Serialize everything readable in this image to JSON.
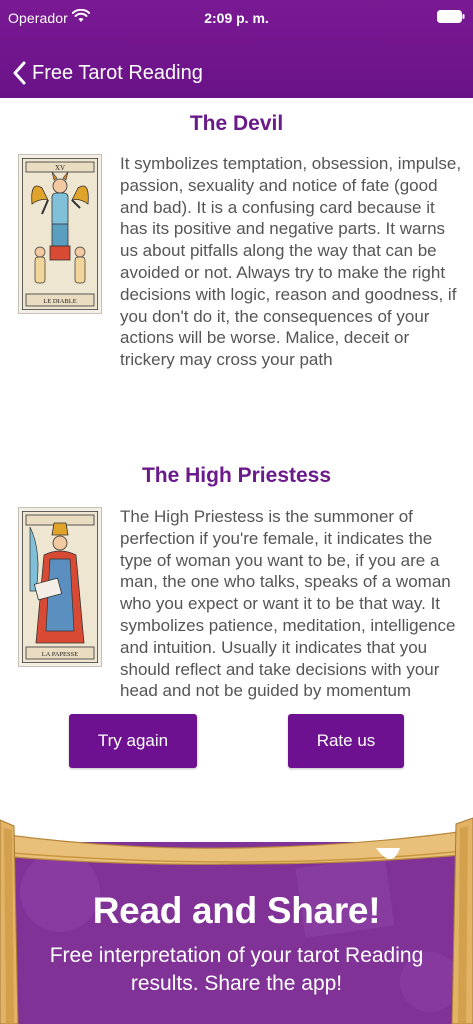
{
  "status_bar": {
    "carrier": "Operador",
    "time": "2:09 p. m."
  },
  "nav": {
    "back_label": "Free Tarot Reading"
  },
  "cards": [
    {
      "title": "The Devil",
      "card_caption": "LE DIABLE",
      "description": "It symbolizes temptation, obsession, impulse, passion, sexuality and notice of fate (good and bad). It is a confusing card because it has its positive and negative parts. It warns us about pitfalls along the way that can be avoided or not. Always try to make the right decisions with logic, reason and goodness, if you don't do it, the consequences of your actions will be worse. Malice, deceit or trickery may cross your path"
    },
    {
      "title": "The High Priestess",
      "card_caption": "LA PAPESSE",
      "description": "The High Priestess is the summoner of perfection if you're female, it indicates the type of woman you want to be, if you are a man, the one who talks, speaks of a woman who you expect or want it to be that way. It symbolizes patience, meditation, intelligence and intuition. Usually it indicates that you should reflect and take decisions with your head and not be guided by momentum"
    }
  ],
  "buttons": {
    "try_again": "Try again",
    "rate_us": "Rate us"
  },
  "promo": {
    "title": "Read and Share!",
    "subtitle": "Free interpretation of your tarot Reading results. Share the app!"
  },
  "colors": {
    "primary": "#6d1190",
    "title_text": "#6a1a8a",
    "promo_bg": "#8a3aa0",
    "scroll_parchment": "#e8c07a"
  }
}
